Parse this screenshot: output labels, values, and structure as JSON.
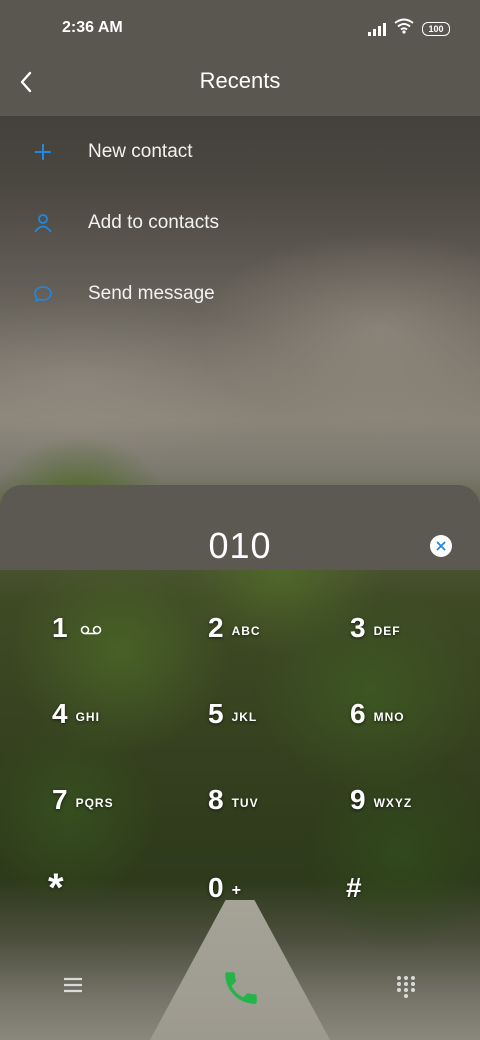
{
  "status_bar": {
    "time": "2:36 AM",
    "battery": "100",
    "icons": [
      "signal-icon",
      "wifi-icon",
      "battery-icon"
    ]
  },
  "header": {
    "title": "Recents",
    "back_icon": "back-arrow-icon"
  },
  "menu": {
    "items": [
      {
        "label": "New contact",
        "icon": "plus-icon"
      },
      {
        "label": "Add to contacts",
        "icon": "person-icon"
      },
      {
        "label": "Send message",
        "icon": "message-bubble-icon"
      }
    ]
  },
  "dialer": {
    "number": "010",
    "clear_icon": "clear-x-icon",
    "keys": [
      {
        "digit": "1",
        "letters": "",
        "icon": "voicemail-icon"
      },
      {
        "digit": "2",
        "letters": "ABC"
      },
      {
        "digit": "3",
        "letters": "DEF"
      },
      {
        "digit": "4",
        "letters": "GHI"
      },
      {
        "digit": "5",
        "letters": "JKL"
      },
      {
        "digit": "6",
        "letters": "MNO"
      },
      {
        "digit": "7",
        "letters": "PQRS"
      },
      {
        "digit": "8",
        "letters": "TUV"
      },
      {
        "digit": "9",
        "letters": "WXYZ"
      },
      {
        "digit": "*",
        "letters": ""
      },
      {
        "digit": "0",
        "letters": "+"
      },
      {
        "digit": "#",
        "letters": ""
      }
    ]
  },
  "bottom_bar": {
    "left_icon": "menu-lines-icon",
    "call_icon": "phone-call-icon",
    "right_icon": "dialpad-grid-icon"
  },
  "colors": {
    "accent": "#1e88e5",
    "call_green": "#26b34a",
    "panel": "#5c5852"
  }
}
